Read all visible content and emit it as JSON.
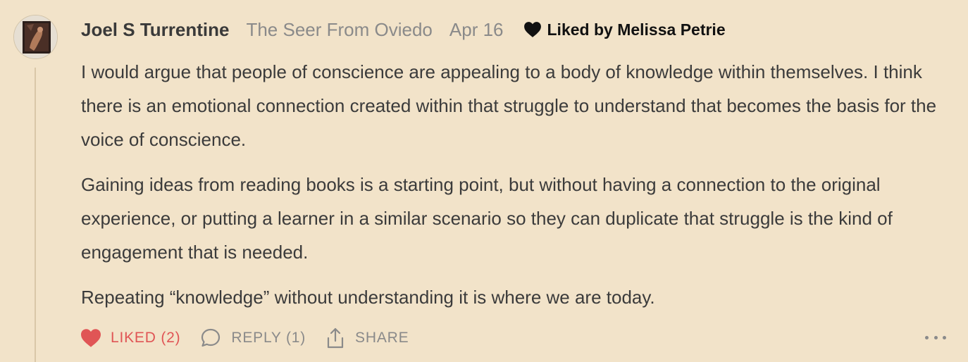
{
  "comment": {
    "author": "Joel S Turrentine",
    "subtitle": "The Seer From Oviedo",
    "date": "Apr 16",
    "liked_by": "Liked by Melissa Petrie",
    "paragraphs": [
      "I would argue that people of conscience are appealing to a body of knowledge within themselves. I think there is an emotional connection created within that struggle to understand that becomes the basis for the voice of conscience.",
      "Gaining ideas from reading books is a starting point, but without having a connection to the original experience, or putting a learner in a similar scenario so they can duplicate that struggle is the kind of engagement that is needed.",
      "Repeating “knowledge” without understanding it is where we are today."
    ]
  },
  "actions": {
    "like_label": "LIKED (2)",
    "reply_label": "REPLY (1)",
    "share_label": "SHARE"
  },
  "icons": {
    "liked_by": "heart-icon",
    "like": "heart-filled-icon",
    "reply": "speech-bubble-icon",
    "share": "share-icon",
    "more": "more-dots-icon"
  },
  "colors": {
    "background": "#f2e3c9",
    "liked": "#e05555",
    "muted": "#8a8a8a",
    "text": "#3b3b3b"
  }
}
